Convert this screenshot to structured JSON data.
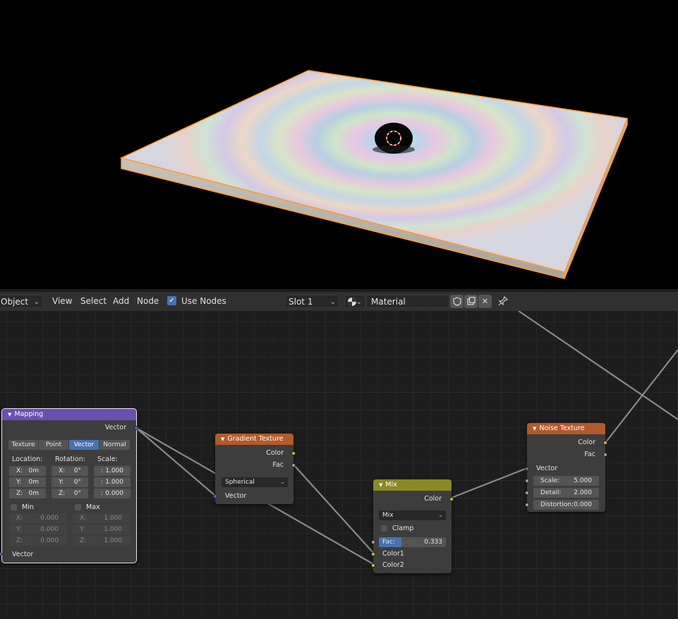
{
  "header": {
    "mode": "Object",
    "menus": [
      "View",
      "Select",
      "Add",
      "Node"
    ],
    "use_nodes_label": "Use Nodes",
    "use_nodes_checked": true,
    "slot": "Slot 1",
    "material_name": "Material"
  },
  "nodes": {
    "mapping": {
      "title": "Mapping",
      "output_vector": "Vector",
      "types": [
        "Texture",
        "Point",
        "Vector",
        "Normal"
      ],
      "active_type": "Vector",
      "location_label": "Location:",
      "rotation_label": "Rotation:",
      "scale_label": "Scale:",
      "location": [
        {
          "axis": "X:",
          "value": "0m"
        },
        {
          "axis": "Y:",
          "value": "0m"
        },
        {
          "axis": "Z:",
          "value": "0m"
        }
      ],
      "rotation": [
        {
          "axis": "X:",
          "value": "0°"
        },
        {
          "axis": "Y:",
          "value": "0°"
        },
        {
          "axis": "Z:",
          "value": "0°"
        }
      ],
      "scale": [
        {
          "axis": ":",
          "value": "1.000"
        },
        {
          "axis": ":",
          "value": "1.000"
        },
        {
          "axis": ":",
          "value": "0.000"
        }
      ],
      "min_label": "Min",
      "max_label": "Max",
      "min": [
        {
          "axis": "X:",
          "value": "0.000"
        },
        {
          "axis": "Y:",
          "value": "0.000"
        },
        {
          "axis": "Z:",
          "value": "0.000"
        }
      ],
      "max": [
        {
          "axis": "X:",
          "value": "1.000"
        },
        {
          "axis": "Y:",
          "value": "1.000"
        },
        {
          "axis": "Z:",
          "value": "1.000"
        }
      ],
      "input_vector": "Vector"
    },
    "gradient": {
      "title": "Gradient Texture",
      "out_color": "Color",
      "out_fac": "Fac",
      "type": "Spherical",
      "input_vector": "Vector"
    },
    "mix": {
      "title": "Mix",
      "out_color": "Color",
      "blend": "Mix",
      "clamp_label": "Clamp",
      "fac_label": "Fac:",
      "fac_value": "0.333",
      "fac_fraction": 0.333,
      "color1": "Color1",
      "color2": "Color2"
    },
    "noise": {
      "title": "Noise Texture",
      "out_color": "Color",
      "out_fac": "Fac",
      "input_vector": "Vector",
      "scale_label": "Scale:",
      "scale_value": "5.000",
      "detail_label": "Detail:",
      "detail_value": "2.000",
      "distortion_label": "Distortion:",
      "distortion_value": "0.000"
    }
  },
  "colors": {
    "vector_socket": "#6363c7",
    "color_socket": "#c7c729",
    "float_socket": "#a1a1a1",
    "mapping_header": "#6a4fb3",
    "texture_header": "#b35a2a",
    "mix_header": "#8a8a24",
    "selection_outline": "#ff9a30",
    "active_button": "#4772b3"
  },
  "icons": [
    "shading-sphere-icon",
    "fake-user-shield-icon",
    "duplicate-icon",
    "close-icon",
    "pin-icon",
    "checkbox-icon",
    "chevron-down-icon"
  ]
}
